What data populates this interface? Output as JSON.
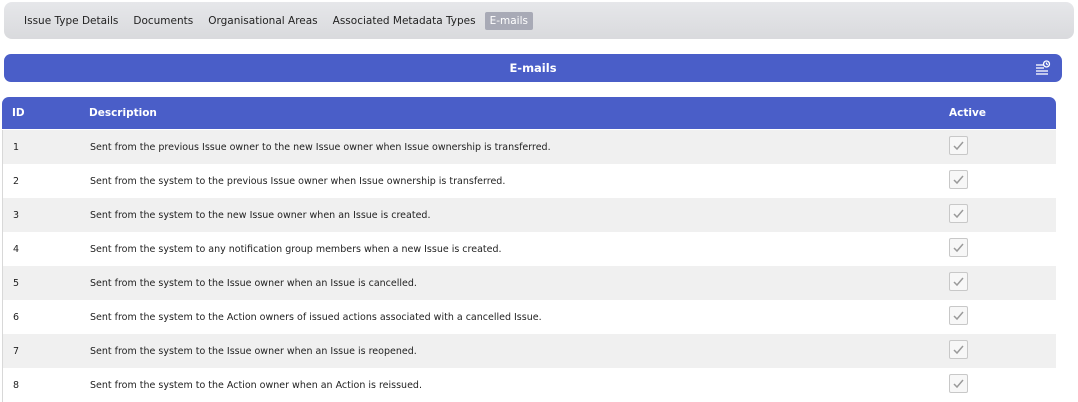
{
  "tabs": [
    {
      "label": "Issue Type Details",
      "active": false
    },
    {
      "label": "Documents",
      "active": false
    },
    {
      "label": "Organisational Areas",
      "active": false
    },
    {
      "label": "Associated Metadata Types",
      "active": false
    },
    {
      "label": "E-mails",
      "active": true
    }
  ],
  "section": {
    "title": "E-mails",
    "menu_icon": "list-settings-icon"
  },
  "table": {
    "columns": {
      "id": "ID",
      "description": "Description",
      "active": "Active"
    },
    "rows": [
      {
        "id": "1",
        "description": "Sent from the previous Issue owner to the new Issue owner when Issue ownership is transferred.",
        "active": true
      },
      {
        "id": "2",
        "description": "Sent from the system to the previous Issue owner when Issue ownership is transferred.",
        "active": true
      },
      {
        "id": "3",
        "description": "Sent from the system to the new Issue owner when an Issue is created.",
        "active": true
      },
      {
        "id": "4",
        "description": "Sent from the system to any notification group members when a new Issue is created.",
        "active": true
      },
      {
        "id": "5",
        "description": "Sent from the system to the Issue owner when an Issue is cancelled.",
        "active": true
      },
      {
        "id": "6",
        "description": "Sent from the system to the Action owners of issued actions associated with a cancelled Issue.",
        "active": true
      },
      {
        "id": "7",
        "description": "Sent from the system to the Issue owner when an Issue is reopened.",
        "active": true
      },
      {
        "id": "8",
        "description": "Sent from the system to the Action owner when an Action is reissued.",
        "active": true
      }
    ]
  },
  "colors": {
    "accent": "#4a5ec8",
    "tab_active": "#a8aab6",
    "row_alt": "#f0f0f0"
  }
}
